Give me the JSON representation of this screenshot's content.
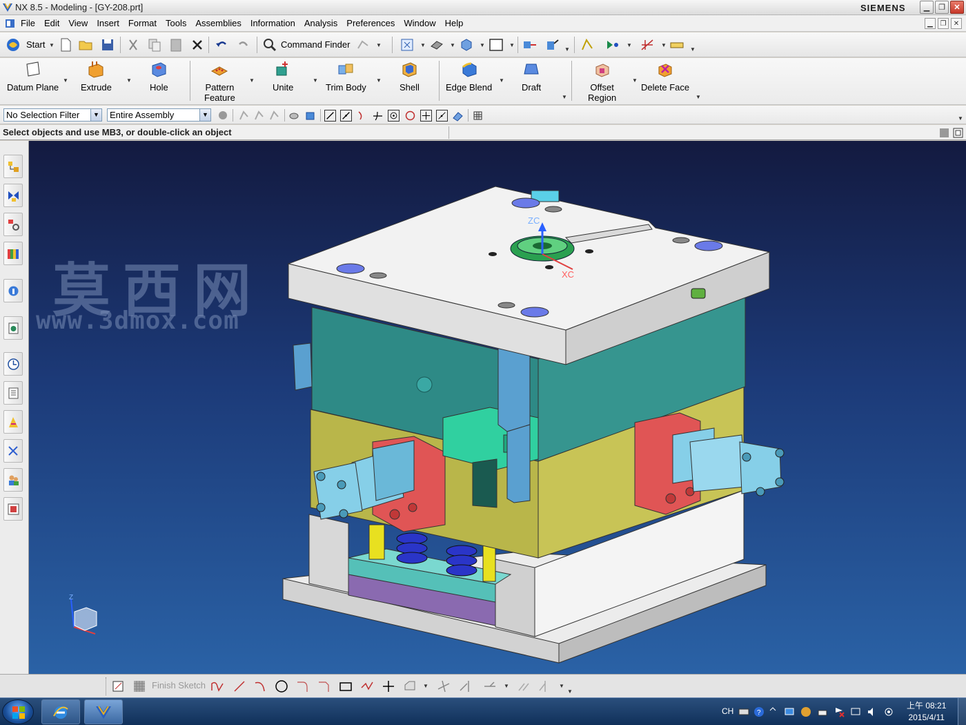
{
  "window": {
    "title": "NX 8.5 - Modeling - [GY-208.prt]",
    "brand": "SIEMENS",
    "controls": {
      "minimize": "▁",
      "restore": "❐",
      "close": "✕"
    }
  },
  "menu": {
    "items": [
      "File",
      "Edit",
      "View",
      "Insert",
      "Format",
      "Tools",
      "Assemblies",
      "Information",
      "Analysis",
      "Preferences",
      "Window",
      "Help"
    ]
  },
  "toolbar_standard": {
    "start_label": "Start",
    "command_finder_label": "Command Finder"
  },
  "feature_toolbar": {
    "datum_plane": "Datum Plane",
    "extrude": "Extrude",
    "hole": "Hole",
    "pattern_feature_line1": "Pattern",
    "pattern_feature_line2": "Feature",
    "unite": "Unite",
    "trim_body": "Trim Body",
    "shell": "Shell",
    "edge_blend": "Edge Blend",
    "draft": "Draft",
    "offset_region_line1": "Offset",
    "offset_region_line2": "Region",
    "delete_face": "Delete Face"
  },
  "selection_bar": {
    "filter_value": "No Selection Filter",
    "scope_value": "Entire Assembly"
  },
  "cue_line": {
    "message": "Select objects and use MB3, or double-click an object"
  },
  "viewport": {
    "watermark_cn": "莫西网",
    "watermark_url": "www.3dmox.com",
    "axis_zc": "ZC",
    "axis_xc": "XC",
    "triad_z": "Z"
  },
  "sketch_toolbar": {
    "finish_sketch": "Finish Sketch"
  },
  "taskbar": {
    "lang": "CH",
    "time": "上午 08:21",
    "date": "2015/4/11"
  },
  "colors": {
    "viewport_top": "#131a40",
    "viewport_bottom": "#2a62a6",
    "plate_white": "#f2f2f2",
    "plate_teal": "#2e8a86",
    "plate_olive": "#b9b64a",
    "slider_red": "#e05555",
    "cylinder_cyan": "#86cfe8",
    "spring_blue": "#2a35c8"
  }
}
